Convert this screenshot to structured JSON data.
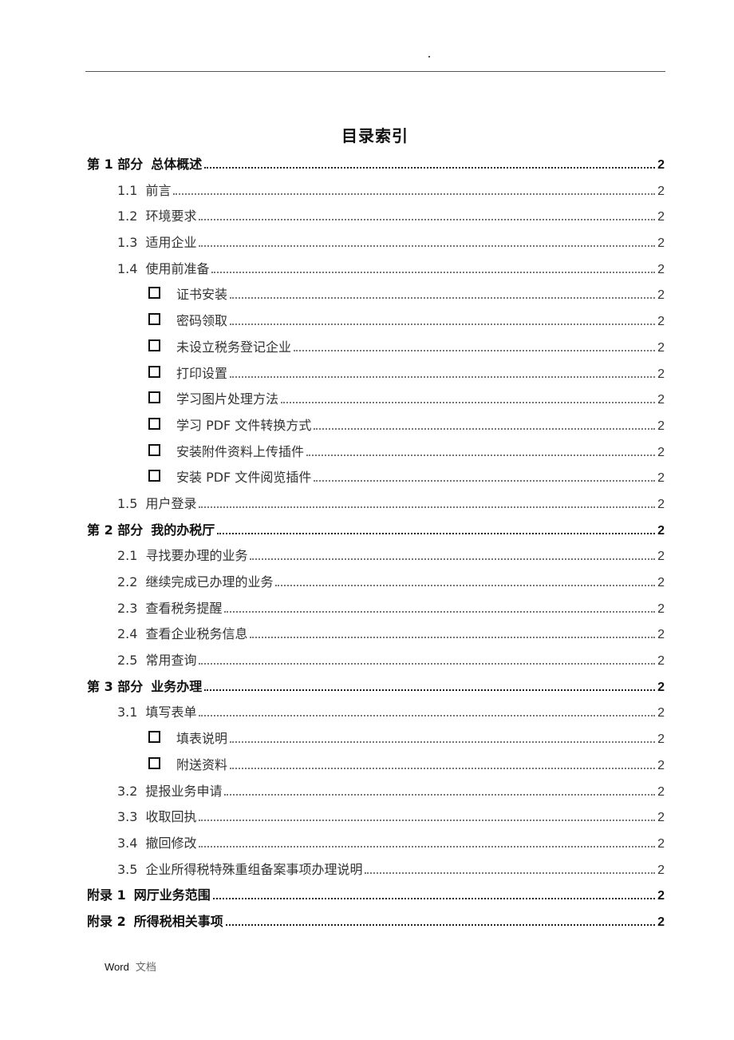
{
  "header": {
    "mark": "."
  },
  "title": "目录索引",
  "toc": [
    {
      "level": 1,
      "num": "第 1 部分",
      "text": "总体概述",
      "page": "2"
    },
    {
      "level": 2,
      "num": "1.1",
      "text": "前言",
      "page": "2"
    },
    {
      "level": 2,
      "num": "1.2",
      "text": "环境要求",
      "page": "2"
    },
    {
      "level": 2,
      "num": "1.3",
      "text": "适用企业",
      "page": "2"
    },
    {
      "level": 2,
      "num": "1.4",
      "text": "使用前准备",
      "page": "2"
    },
    {
      "level": 3,
      "num": "",
      "text": "证书安装",
      "page": "2"
    },
    {
      "level": 3,
      "num": "",
      "text": "密码领取",
      "page": "2"
    },
    {
      "level": 3,
      "num": "",
      "text": "未设立税务登记企业",
      "page": "2"
    },
    {
      "level": 3,
      "num": "",
      "text": "打印设置",
      "page": "2"
    },
    {
      "level": 3,
      "num": "",
      "text": "学习图片处理方法",
      "page": "2"
    },
    {
      "level": 3,
      "num": "",
      "text": "学习 PDF 文件转换方式",
      "page": "2"
    },
    {
      "level": 3,
      "num": "",
      "text": "安装附件资料上传插件",
      "page": "2"
    },
    {
      "level": 3,
      "num": "",
      "text": "安装 PDF 文件阅览插件",
      "page": "2"
    },
    {
      "level": 2,
      "num": "1.5",
      "text": "用户登录",
      "page": "2"
    },
    {
      "level": 1,
      "num": "第 2 部分",
      "text": "我的办税厅",
      "page": "2"
    },
    {
      "level": 2,
      "num": "2.1",
      "text": "寻找要办理的业务",
      "page": "2"
    },
    {
      "level": 2,
      "num": "2.2",
      "text": "继续完成已办理的业务",
      "page": "2"
    },
    {
      "level": 2,
      "num": "2.3",
      "text": "查看税务提醒",
      "page": "2"
    },
    {
      "level": 2,
      "num": "2.4",
      "text": "查看企业税务信息",
      "page": "2"
    },
    {
      "level": 2,
      "num": "2.5",
      "text": "常用查询",
      "page": "2"
    },
    {
      "level": 1,
      "num": "第 3 部分",
      "text": "业务办理",
      "page": "2"
    },
    {
      "level": 2,
      "num": "3.1",
      "text": "填写表单",
      "page": "2"
    },
    {
      "level": 3,
      "num": "",
      "text": "填表说明",
      "page": "2"
    },
    {
      "level": 3,
      "num": "",
      "text": "附送资料",
      "page": "2"
    },
    {
      "level": 2,
      "num": "3.2",
      "text": "提报业务申请",
      "page": "2"
    },
    {
      "level": 2,
      "num": "3.3",
      "text": "收取回执",
      "page": "2"
    },
    {
      "level": 2,
      "num": "3.4",
      "text": "撤回修改",
      "page": "2"
    },
    {
      "level": 2,
      "num": "3.5",
      "text": "企业所得税特殊重组备案事项办理说明",
      "page": "2"
    },
    {
      "level": 1,
      "num": "附录 1",
      "text": "网厅业务范围",
      "page": "2"
    },
    {
      "level": 1,
      "num": "附录 2",
      "text": "所得税相关事项",
      "page": "2"
    }
  ],
  "footer": {
    "app": "Word",
    "label": "文档"
  }
}
